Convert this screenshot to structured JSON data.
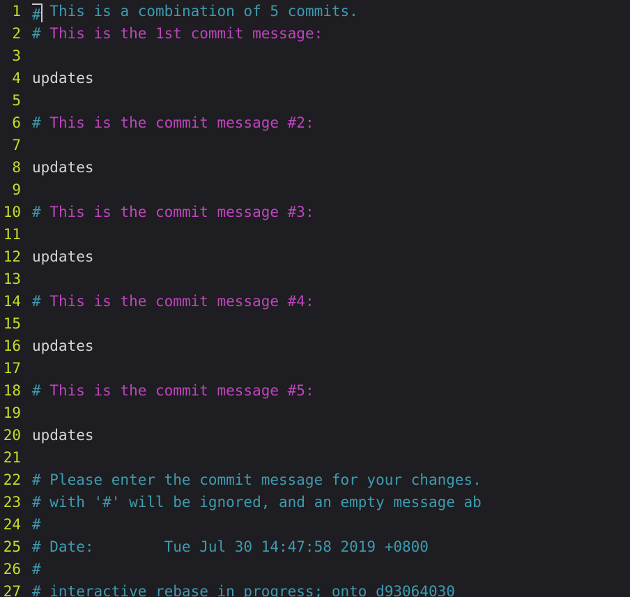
{
  "editor": {
    "kind": "vim-commit-message-buffer",
    "background_color": "#1e1d21",
    "line_number_color": "#cadb2a",
    "comment_color": "#3e9bb0",
    "magenta_color": "#bd46bd",
    "text_color": "#d5d5d8",
    "cursor_color": "#c9c9cf",
    "cursor_line": 1,
    "cursor_column": 1,
    "first_visible_line": 1,
    "last_visible_line": 27
  },
  "lines": [
    {
      "number": "1",
      "segments": [
        {
          "text": "#",
          "style": "hash",
          "cursor": true
        },
        {
          "text": " This is a combination of 5 commits.",
          "style": "comment"
        }
      ]
    },
    {
      "number": "2",
      "segments": [
        {
          "text": "#",
          "style": "hash"
        },
        {
          "text": " This is the 1st commit message:",
          "style": "magenta"
        }
      ]
    },
    {
      "number": "3",
      "segments": []
    },
    {
      "number": "4",
      "segments": [
        {
          "text": "updates",
          "style": "text"
        }
      ]
    },
    {
      "number": "5",
      "segments": []
    },
    {
      "number": "6",
      "segments": [
        {
          "text": "#",
          "style": "hash"
        },
        {
          "text": " This is the commit message #2:",
          "style": "magenta"
        }
      ]
    },
    {
      "number": "7",
      "segments": []
    },
    {
      "number": "8",
      "segments": [
        {
          "text": "updates",
          "style": "text"
        }
      ]
    },
    {
      "number": "9",
      "segments": []
    },
    {
      "number": "10",
      "segments": [
        {
          "text": "#",
          "style": "hash"
        },
        {
          "text": " This is the commit message #3:",
          "style": "magenta"
        }
      ]
    },
    {
      "number": "11",
      "segments": []
    },
    {
      "number": "12",
      "segments": [
        {
          "text": "updates",
          "style": "text"
        }
      ]
    },
    {
      "number": "13",
      "segments": []
    },
    {
      "number": "14",
      "segments": [
        {
          "text": "#",
          "style": "hash"
        },
        {
          "text": " This is the commit message #4:",
          "style": "magenta"
        }
      ]
    },
    {
      "number": "15",
      "segments": []
    },
    {
      "number": "16",
      "segments": [
        {
          "text": "updates",
          "style": "text"
        }
      ]
    },
    {
      "number": "17",
      "segments": []
    },
    {
      "number": "18",
      "segments": [
        {
          "text": "#",
          "style": "hash"
        },
        {
          "text": " This is the commit message #5:",
          "style": "magenta"
        }
      ]
    },
    {
      "number": "19",
      "segments": []
    },
    {
      "number": "20",
      "segments": [
        {
          "text": "updates",
          "style": "text"
        }
      ]
    },
    {
      "number": "21",
      "segments": []
    },
    {
      "number": "22",
      "segments": [
        {
          "text": "# Please enter the commit message for your changes.",
          "style": "comment"
        }
      ]
    },
    {
      "number": "23",
      "segments": [
        {
          "text": "# with '#' will be ignored, and an empty message ab",
          "style": "comment"
        }
      ]
    },
    {
      "number": "24",
      "segments": [
        {
          "text": "#",
          "style": "comment"
        }
      ]
    },
    {
      "number": "25",
      "segments": [
        {
          "text": "# Date:        Tue Jul 30 14:47:58 2019 +0800",
          "style": "comment"
        }
      ]
    },
    {
      "number": "26",
      "segments": [
        {
          "text": "#",
          "style": "comment"
        }
      ]
    },
    {
      "number": "27",
      "segments": [
        {
          "text": "# interactive rebase in progress; onto d93064030",
          "style": "comment"
        }
      ]
    }
  ]
}
